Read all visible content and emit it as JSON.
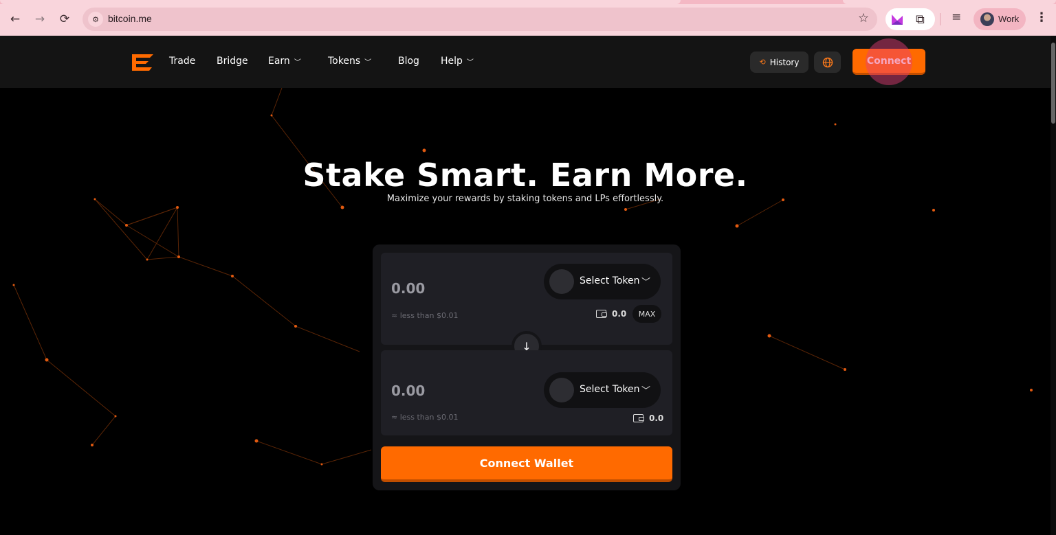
{
  "browser": {
    "url": "bitcoin.me",
    "profile_label": "Work",
    "icons": [
      "back-icon",
      "forward-icon",
      "reload-icon",
      "site-info-icon",
      "bookmark-star-icon",
      "extension-icon",
      "puzzle-icon",
      "media-control-icon",
      "avatar",
      "kebab-menu-icon"
    ]
  },
  "header": {
    "nav": {
      "trade": "Trade",
      "bridge": "Bridge",
      "earn": "Earn",
      "tokens": "Tokens",
      "blog": "Blog",
      "help": "Help"
    },
    "history_label": "History",
    "connect_label": "Connect"
  },
  "hero": {
    "title": "Stake Smart. Earn More.",
    "subtitle": "Maximize your rewards by staking tokens and LPs effortlessly."
  },
  "swap": {
    "from": {
      "amount": "0.00",
      "usd": "≈ less than $0.01",
      "token_label": "Select Token",
      "balance": "0.0",
      "max_label": "MAX"
    },
    "to": {
      "amount": "0.00",
      "usd": "≈ less than $0.01",
      "token_label": "Select Token",
      "balance": "0.0"
    },
    "connect_wallet_label": "Connect Wallet"
  },
  "colors": {
    "accent": "#ff6a00",
    "background": "#000000",
    "header_bg": "#141414",
    "card_bg": "#151518",
    "panel_bg": "#1f1f25"
  }
}
